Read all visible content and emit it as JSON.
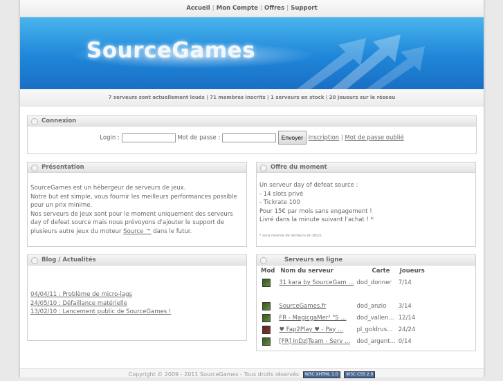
{
  "nav": {
    "items": [
      "Accueil",
      "Mon Compte",
      "Offres",
      "Support"
    ]
  },
  "banner": {
    "logo": "SourceGames"
  },
  "stats": "7 serveurs sont actuellement loués | 71 membres inscrits | 1 serveurs en stock | 20 joueurs sur le réseau",
  "login": {
    "title": "Connexion",
    "login_label": "Login :",
    "password_label": "Mot de passe :",
    "submit": "Envoyer",
    "register_link": "Inscription",
    "sep": "|",
    "forgot_link": "Mot de passe oublié"
  },
  "presentation": {
    "title": "Présentation",
    "p1": "SourceGames est un hébergeur de serveurs de jeux.",
    "p2": "Notre but est simple, vous fournir les meilleurs performances possible pour un prix minime.",
    "p3a": "Nos serveurs de jeux sont pour le moment uniquement des serveurs day of defeat source mais nous prévoyons d'ajouter le support de plusieurs autre jeux du moteur ",
    "p3link": "Source ™",
    "p3b": " dans le futur."
  },
  "offer": {
    "title": "Offre du moment",
    "lines": [
      "Un serveur day of defeat source :",
      "- 14 slots privé",
      "- Tickrate 100",
      "Pour 15€ par mois sans engagement !",
      "Livré dans la minute suivant l'achat ! *"
    ],
    "note": "* sous reserve de serveurs en stock."
  },
  "blog": {
    "title": "Blog / Actualités",
    "items": [
      "04/04/11 : Problème de micro-lags",
      "24/05/10 : Défaillance matérielle",
      "13/02/10 : Lancement public de SourceGames !"
    ]
  },
  "servers": {
    "title": "Serveurs en ligne",
    "headers": [
      "Mod",
      "Nom du serveur",
      "Carte",
      "Joueurs"
    ],
    "rows": [
      {
        "name": "31 kara by SourceGam ...",
        "map": "dod_donner",
        "players": "7/14"
      },
      {
        "name": "SourceGames.fr",
        "map": "dod_anzio",
        "players": "3/14"
      },
      {
        "name": "FR - MagicgaMer² \"S ...",
        "map": "dod_vallen...",
        "players": "12/14"
      },
      {
        "name": "♥ Fap2Play ♥ - Pay ...",
        "map": "pl_goldrus...",
        "players": "24/24"
      },
      {
        "name": "[FR] InDz|Team - Serv ...",
        "map": "dod_argent...",
        "players": "0/14"
      }
    ]
  },
  "footer": {
    "text": "Copyright © 2009 - 2011 SourceGames - Tous droits réservés",
    "badge1": "W3C XHTML 1.0",
    "badge2": "W3C CSS 2.0"
  }
}
